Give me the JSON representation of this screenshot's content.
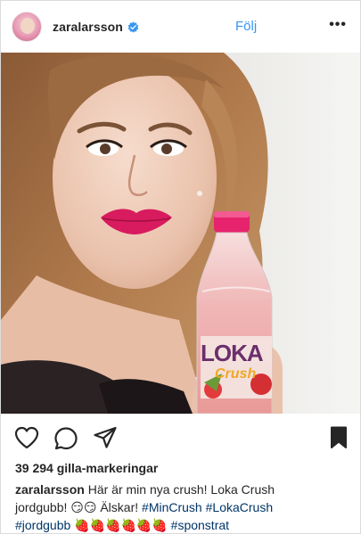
{
  "header": {
    "username": "zaralarsson",
    "follow_label": "Följ",
    "more_label": "•••"
  },
  "post": {
    "bottle_brand": "LOKA",
    "bottle_product": "Crush"
  },
  "likes": {
    "text": "39 294 gilla-markeringar"
  },
  "caption": {
    "username": "zaralarsson",
    "text_1": "Här är min nya crush! Loka Crush",
    "text_2": "jordgubb! 😏😏 Älskar!",
    "tag_mincrush": "#MinCrush",
    "tag_lokacrush": "#LokaCrush",
    "tag_jordgubb": "#jordgubb",
    "strawberries": "🍓🍓🍓🍓🍓🍓",
    "tag_sponstrat": "#sponstrat"
  },
  "icons": [
    "verified-icon",
    "more-icon",
    "heart-icon",
    "comment-icon",
    "share-icon",
    "bookmark-icon"
  ],
  "colors": {
    "link": "#3897f0",
    "hashtag": "#003569",
    "text": "#262626",
    "lipstick": "#d81b5e"
  }
}
